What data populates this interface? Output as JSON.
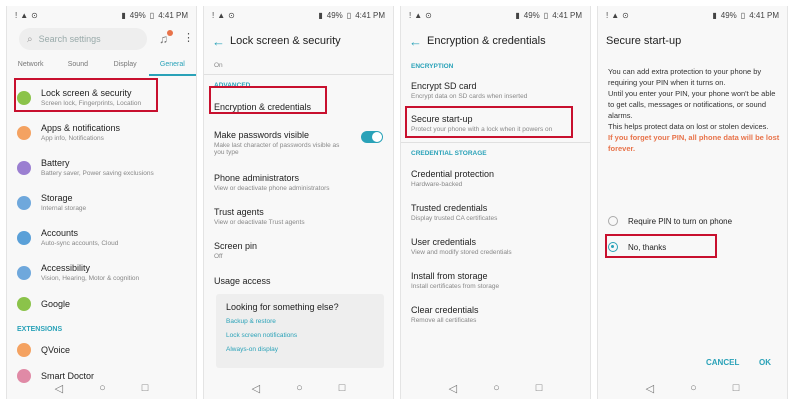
{
  "status": {
    "left_icons": [
      "!",
      "▲",
      "⊙"
    ],
    "battery": "49%",
    "time": "4:41 PM"
  },
  "screen1": {
    "search_placeholder": "Search settings",
    "tabs": [
      "Network",
      "Sound",
      "Display",
      "General"
    ],
    "items": [
      {
        "title": "Lock screen & security",
        "sub": "Screen lock, Fingerprints, Location",
        "color": "#8bc34a"
      },
      {
        "title": "Apps & notifications",
        "sub": "App info, Notifications",
        "color": "#f4a261"
      },
      {
        "title": "Battery",
        "sub": "Battery saver, Power saving exclusions",
        "color": "#9b7fd1"
      },
      {
        "title": "Storage",
        "sub": "Internal storage",
        "color": "#6fa8dc"
      },
      {
        "title": "Accounts",
        "sub": "Auto-sync accounts, Cloud",
        "color": "#5aa0d8"
      },
      {
        "title": "Accessibility",
        "sub": "Vision, Hearing, Motor & cognition",
        "color": "#6fa8dc"
      },
      {
        "title": "Google",
        "sub": "",
        "color": "#8bc34a"
      }
    ],
    "extensions_label": "EXTENSIONS",
    "ext_items": [
      {
        "title": "QVoice",
        "color": "#f4a261"
      },
      {
        "title": "Smart Doctor",
        "color": "#e08aa6"
      }
    ]
  },
  "screen2": {
    "title": "Lock screen & security",
    "top_text": "On",
    "advanced": "ADVANCED",
    "items": [
      {
        "title": "Encryption & credentials",
        "sub": ""
      },
      {
        "title": "Make passwords visible",
        "sub": "Make last character of passwords visible as you type"
      },
      {
        "title": "Phone administrators",
        "sub": "View or deactivate phone administrators"
      },
      {
        "title": "Trust agents",
        "sub": "View or deactivate Trust agents"
      },
      {
        "title": "Screen pin",
        "sub": "Off"
      },
      {
        "title": "Usage access",
        "sub": ""
      }
    ],
    "card": {
      "heading": "Looking for something else?",
      "links": [
        "Backup & restore",
        "Lock screen notifications",
        "Always-on display"
      ]
    }
  },
  "screen3": {
    "title": "Encryption & credentials",
    "enc_header": "ENCRYPTION",
    "enc_items": [
      {
        "title": "Encrypt SD card",
        "sub": "Encrypt data on SD cards when inserted"
      },
      {
        "title": "Secure start-up",
        "sub": "Protect your phone with a lock when it powers on"
      }
    ],
    "cred_header": "CREDENTIAL STORAGE",
    "cred_items": [
      {
        "title": "Credential protection",
        "sub": "Hardware-backed"
      },
      {
        "title": "Trusted credentials",
        "sub": "Display trusted CA certificates"
      },
      {
        "title": "User credentials",
        "sub": "View and modify stored credentials"
      },
      {
        "title": "Install from storage",
        "sub": "Install certificates from storage"
      },
      {
        "title": "Clear credentials",
        "sub": "Remove all certificates"
      }
    ]
  },
  "screen4": {
    "title": "Secure start-up",
    "para1": "You can add extra protection to your phone by requiring your PIN when it turns on.",
    "para2": "Until you enter your PIN, your phone won't be able to get calls, messages or notifications, or sound alarms.",
    "para3": "This helps protect data on lost or stolen devices.",
    "warning": "If you forget your PIN, all phone data will be lost forever.",
    "option1": "Require PIN to turn on phone",
    "option2": "No, thanks",
    "cancel": "CANCEL",
    "ok": "OK"
  },
  "nav": {
    "back": "◁",
    "home": "○",
    "recents": "□"
  },
  "colors": {
    "accent": "#2aa2b8",
    "highlight": "#c8102e",
    "warning": "#e8734a"
  }
}
